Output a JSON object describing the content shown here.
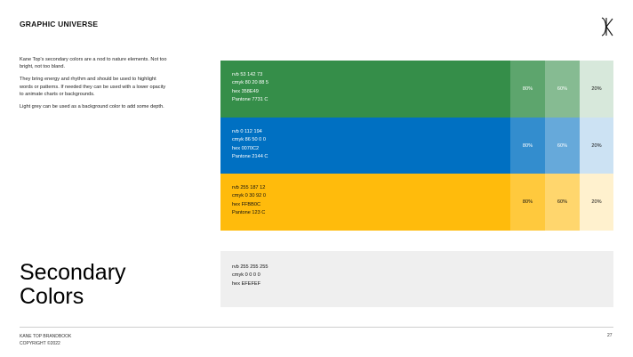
{
  "header": {
    "title": "GRAPHIC UNIVERSE"
  },
  "logo": {
    "icon": "kane-top-k-monogram-icon"
  },
  "intro": {
    "p1": "Kane Top's secondary colors are a nod to nature elements. Not too bright, not too bland.",
    "p2": "They bring energy and rhythm and should be used to highlight words or patterns. If needed they can be used with a lower opacity to animate charts or backgrounds.",
    "p3": "Light grey can be used as a background color to add some depth."
  },
  "title": {
    "line1": "Secondary",
    "line2": "Colors"
  },
  "swatches": [
    {
      "name": "green",
      "color": "#358E49",
      "text_color": "#ffffff",
      "rvb": "rvb 53 142 73",
      "cmyk": "cmyk 80 20 88 5",
      "hex": "hex 358E49",
      "pantone": "Pantone 7731 C",
      "tints": [
        {
          "label": "80%",
          "color": "#5DA56D",
          "text_color": "#ffffff"
        },
        {
          "label": "60%",
          "color": "#86BB92",
          "text_color": "#ffffff"
        },
        {
          "label": "20%",
          "color": "#D7E8DB",
          "text_color": "#111111"
        }
      ]
    },
    {
      "name": "blue",
      "color": "#0070C2",
      "text_color": "#ffffff",
      "rvb": "rvb 0 112 194",
      "cmyk": "cmyk 86 50 0 0",
      "hex": "hex 0070C2",
      "pantone": "Pantone 2144 C",
      "tints": [
        {
          "label": "80%",
          "color": "#338DCE",
          "text_color": "#ffffff"
        },
        {
          "label": "60%",
          "color": "#66A9DA",
          "text_color": "#ffffff"
        },
        {
          "label": "20%",
          "color": "#CCE2F3",
          "text_color": "#111111"
        }
      ]
    },
    {
      "name": "yellow",
      "color": "#FFBB0C",
      "text_color": "#111111",
      "rvb": "rvb 255 187 12",
      "cmyk": "cmyk 0 30 92 0",
      "hex": "hex FFBB0C",
      "pantone": "Pantone 123 C",
      "tints": [
        {
          "label": "80%",
          "color": "#FFC93D",
          "text_color": "#111111"
        },
        {
          "label": "60%",
          "color": "#FFD66D",
          "text_color": "#111111"
        },
        {
          "label": "20%",
          "color": "#FFF1CE",
          "text_color": "#111111"
        }
      ]
    }
  ],
  "grey": {
    "color": "#EFEFEF",
    "rvb": "rvb 255 255 255",
    "cmyk": "cmyk 0 0 0 0",
    "hex": "hex EFEFEF"
  },
  "footer": {
    "brand": "KANE TOP BRANDBOOK",
    "copyright": "COPYRIGHT ©2022",
    "page": "27"
  }
}
